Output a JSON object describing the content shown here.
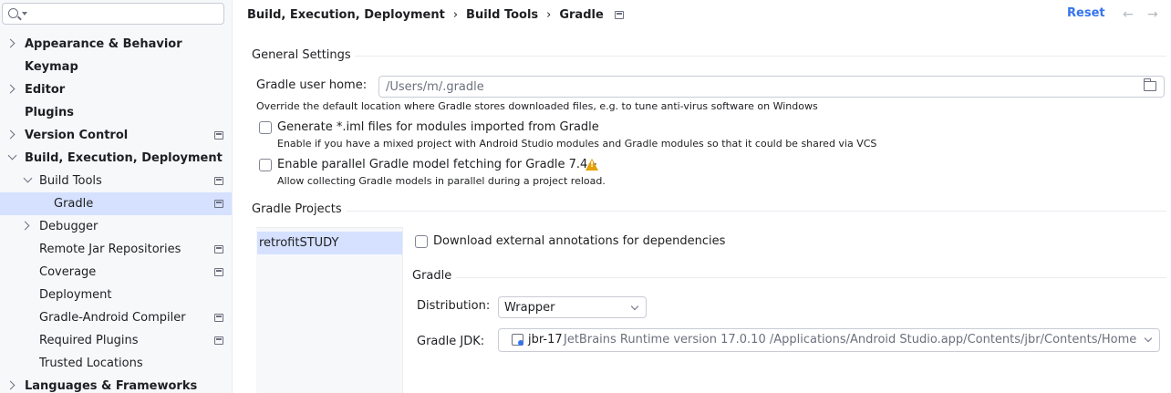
{
  "sidebar": {
    "search_placeholder": "",
    "items": [
      {
        "label": "Appearance & Behavior"
      },
      {
        "label": "Keymap"
      },
      {
        "label": "Editor"
      },
      {
        "label": "Plugins"
      },
      {
        "label": "Version Control"
      },
      {
        "label": "Build, Execution, Deployment"
      },
      {
        "label": "Build Tools"
      },
      {
        "label": "Gradle"
      },
      {
        "label": "Debugger"
      },
      {
        "label": "Remote Jar Repositories"
      },
      {
        "label": "Coverage"
      },
      {
        "label": "Deployment"
      },
      {
        "label": "Gradle-Android Compiler"
      },
      {
        "label": "Required Plugins"
      },
      {
        "label": "Trusted Locations"
      },
      {
        "label": "Languages & Frameworks"
      }
    ]
  },
  "header": {
    "breadcrumbs": [
      "Build, Execution, Deployment",
      "Build Tools",
      "Gradle"
    ],
    "separator": "›",
    "reset_label": "Reset",
    "back_glyph": "←",
    "forward_glyph": "→"
  },
  "general": {
    "title": "General Settings",
    "gradle_home_label": "Gradle user home:",
    "gradle_home_placeholder": "/Users/m/.gradle",
    "gradle_home_hint": "Override the default location where Gradle stores downloaded files, e.g. to tune anti-virus software on Windows",
    "iml_label": "Generate *.iml files for modules imported from Gradle",
    "iml_hint": "Enable if you have a mixed project with Android Studio modules and Gradle modules so that it could be shared via VCS",
    "parallel_label": "Enable parallel Gradle model fetching for Gradle 7.4+",
    "parallel_hint": "Allow collecting Gradle models in parallel during a project reload."
  },
  "projects": {
    "title": "Gradle Projects",
    "items": [
      "retrofitSTUDY"
    ],
    "download_annotations_label": "Download external annotations for dependencies",
    "gradle_subtitle": "Gradle",
    "distribution_label": "Distribution:",
    "distribution_value": "Wrapper",
    "jdk_label": "Gradle JDK:",
    "jdk_name": "jbr-17",
    "jdk_detail": "JetBrains Runtime version 17.0.10 /Applications/Android Studio.app/Contents/jbr/Contents/Home"
  }
}
